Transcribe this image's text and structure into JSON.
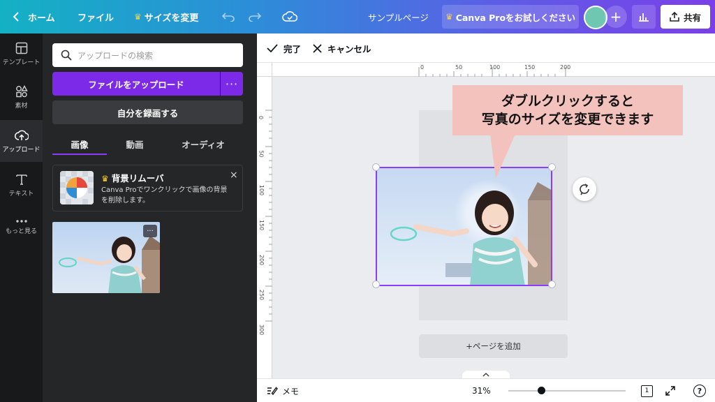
{
  "topbar": {
    "home_label": "ホーム",
    "file_label": "ファイル",
    "resize_label": "サイズを変更",
    "doc_title": "サンプルページ",
    "pro_label": "Canva Proをお試しください",
    "plus_label": "+",
    "share_label": "共有"
  },
  "rail": {
    "items": [
      {
        "label": "テンプレート",
        "icon": "template-icon"
      },
      {
        "label": "素材",
        "icon": "elements-icon"
      },
      {
        "label": "アップロード",
        "icon": "upload-cloud-icon"
      },
      {
        "label": "テキスト",
        "icon": "text-icon"
      },
      {
        "label": "もっと見る",
        "icon": "more-dots-icon"
      }
    ]
  },
  "panel": {
    "search_placeholder": "アップロードの検索",
    "upload_button": "ファイルをアップロード",
    "upload_more": "···",
    "record_button": "自分を録画する",
    "tabs": [
      "画像",
      "動画",
      "オーディオ"
    ],
    "promo_title": "背景リムーバ",
    "promo_text": "Canva Proでワンクリックで画像の背景を削除します。",
    "promo_close": "×",
    "thumb_more": "···"
  },
  "editor": {
    "done_label": "完了",
    "cancel_label": "キャンセル",
    "ruler_h": [
      "0",
      "50",
      "100",
      "150",
      "200"
    ],
    "ruler_v": [
      "0",
      "50",
      "100",
      "150",
      "200",
      "250",
      "300"
    ],
    "callout_line1": "ダブルクリックすると",
    "callout_line2": "写真のサイズを変更できます",
    "add_page": "+ページを追加"
  },
  "bottombar": {
    "notes_label": "メモ",
    "zoom": "31%",
    "page_count": "1",
    "help": "?"
  },
  "colors": {
    "accent": "#7d2ae8",
    "selection": "#8b3dff",
    "callout_bg": "#f4c2bd"
  }
}
